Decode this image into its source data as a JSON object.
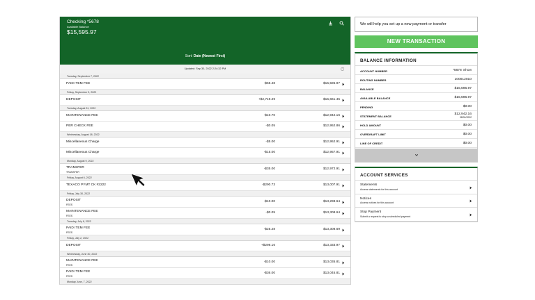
{
  "account": {
    "name": "Checking *5678",
    "balance_label": "Available Balance",
    "balance": "$15,595.97",
    "icons": [
      "download-icon",
      "search-icon"
    ]
  },
  "sort": {
    "prefix": "Sort:",
    "value": "Date (Newest First)"
  },
  "updated": "Updated: Sep 30, 2022 2:24:32 PM",
  "groups": [
    {
      "date": "Tuesday, September 7, 2022",
      "items": [
        {
          "desc": "PAID ITEM FEE",
          "sub": "",
          "amount": "-$65.48",
          "balance": "$15,595.97"
        }
      ]
    },
    {
      "date": "Friday, September 3, 2022",
      "items": [
        {
          "desc": "DEPOSIT",
          "sub": "",
          "amount": "+$2,719.29",
          "balance": "$15,661.45"
        }
      ]
    },
    {
      "date": "Tuesday, August 31, 2022",
      "items": [
        {
          "desc": "MAINTENANCE FEE",
          "sub": "",
          "amount": "-$10.70",
          "balance": "$12,942.16"
        },
        {
          "desc": "PER CHECK FEE",
          "sub": "",
          "amount": "-$0.05",
          "balance": "$12,952.86"
        }
      ]
    },
    {
      "date": "Wednesday, August 18, 2022",
      "items": [
        {
          "desc": "Miscellaneous Charge",
          "sub": "",
          "amount": "-$5.00",
          "balance": "$12,952.91"
        },
        {
          "desc": "Miscellaneous Charge",
          "sub": "",
          "amount": "-$15.00",
          "balance": "$12,957.91"
        }
      ]
    },
    {
      "date": "Monday, August 9, 2022",
      "items": [
        {
          "desc": "TRANSFER",
          "sub": "TRANSFER",
          "amount": "-$35.00",
          "balance": "$12,972.91"
        }
      ]
    },
    {
      "date": "Friday, August 6, 2022",
      "items": [
        {
          "desc": "TEXACO PYMT CK #2222",
          "sub": "",
          "amount": "-$290.73",
          "balance": "$13,007.91"
        }
      ]
    },
    {
      "date": "Friday, July 30, 2022",
      "items": [
        {
          "desc": "DEPOSIT",
          "sub": "FEES",
          "amount": "-$10.00",
          "balance": "$13,298.64"
        },
        {
          "desc": "MAINTENANCE FEE",
          "sub": "FEES",
          "amount": "-$0.05",
          "balance": "$13,308.64"
        }
      ]
    },
    {
      "date": "Tuesday, July 6, 2022",
      "items": [
        {
          "desc": "PAID ITEM FEE",
          "sub": "FEES",
          "amount": "-$25.28",
          "balance": "$13,308.69"
        }
      ]
    },
    {
      "date": "Friday, July 2, 2022",
      "items": [
        {
          "desc": "DEPOSIT",
          "sub": "",
          "amount": "+$298.16",
          "balance": "$13,333.97"
        }
      ]
    },
    {
      "date": "Wednesday, June 30, 2022",
      "items": [
        {
          "desc": "MAINTENANCE FEE",
          "sub": "FEES",
          "amount": "-$10.00",
          "balance": "$13,035.81"
        },
        {
          "desc": "PAID ITEM FEE",
          "sub": "FEES",
          "amount": "-$36.00",
          "balance": "$13,045.81"
        }
      ]
    },
    {
      "date": "Monday June, 7, 2022",
      "items": []
    }
  ],
  "help_text": "We will help you set up a new payment or transfer",
  "new_transaction": "NEW TRANSACTION",
  "balance_info": {
    "title": "BALANCE INFORMATION",
    "rows": [
      {
        "label": "ACCOUNT NUMBER",
        "value": "*5678",
        "extra": "Show"
      },
      {
        "label": "ROUTING NUMBER",
        "value": "100012010"
      },
      {
        "label": "BALANCE",
        "value": "$15,595.97"
      },
      {
        "label": "AVAILABLE BALANCE",
        "value": "$15,595.97"
      },
      {
        "label": "PENDING",
        "value": "$0.00"
      },
      {
        "label": "STATEMENT BALANCE",
        "value": "$12,942.16",
        "date": "08/31/2022"
      },
      {
        "label": "HOLD AMOUNT",
        "value": "$0.00"
      },
      {
        "label": "OVERDRAFT LIMIT",
        "value": "$0.00"
      },
      {
        "label": "LINE OF CREDIT",
        "value": "$0.00"
      }
    ]
  },
  "services": {
    "title": "ACCOUNT SERVICES",
    "items": [
      {
        "title": "Statements",
        "sub": "Access statements for this account"
      },
      {
        "title": "Notices",
        "sub": "Access notices for this account"
      },
      {
        "title": "Stop Payment",
        "sub": "Submit a request to stop a scheduled payment"
      }
    ]
  },
  "colors": {
    "brand_green": "#136428",
    "button_green": "#5fc45e",
    "row_gray": "#f0f0f0"
  }
}
